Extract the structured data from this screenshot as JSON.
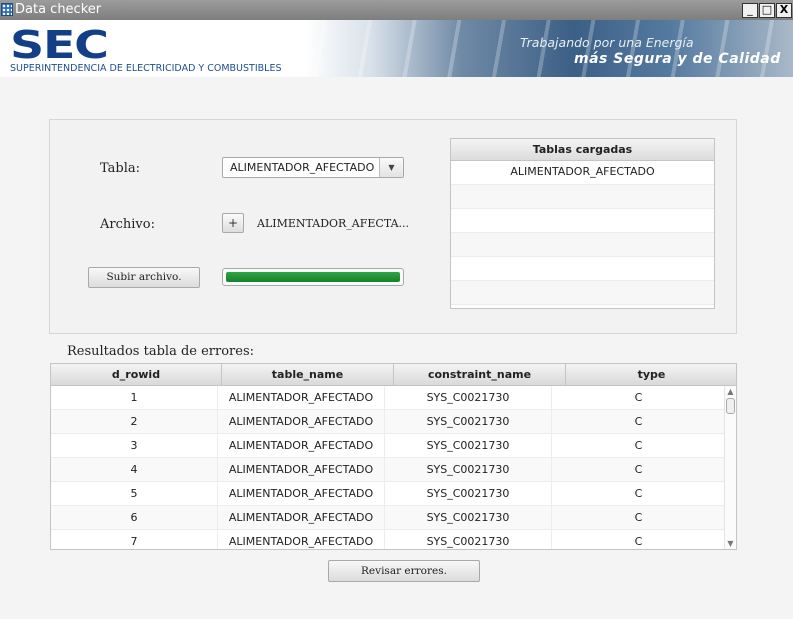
{
  "window": {
    "title": "Data checker",
    "controls": {
      "minimize": "_",
      "maximize": "□",
      "close": "X"
    }
  },
  "banner": {
    "logo_text": "SEC",
    "logo_subtitle": "SUPERINTENDENCIA DE ELECTRICIDAD Y COMBUSTIBLES",
    "slogan_line1": "Trabajando por una Energía",
    "slogan_line2": "más Segura y de Calidad",
    "brand_color": "#123f86"
  },
  "upload": {
    "tabla_label": "Tabla:",
    "tabla_selected": "ALIMENTADOR_AFECTADO",
    "archivo_label": "Archivo:",
    "browse_label": "+",
    "archivo_value": "ALIMENTADOR_AFECTA...",
    "upload_button": "Subir archivo.",
    "progress_fraction": 1.0,
    "progress_color": "#1f8f35"
  },
  "loaded_tables": {
    "header": "Tablas cargadas",
    "rows": [
      "ALIMENTADOR_AFECTADO",
      "",
      "",
      "",
      "",
      ""
    ]
  },
  "results": {
    "title": "Resultados tabla de errores:",
    "columns": [
      "d_rowid",
      "table_name",
      "constraint_name",
      "type"
    ],
    "rows": [
      [
        "1",
        "ALIMENTADOR_AFECTADO",
        "SYS_C0021730",
        "C"
      ],
      [
        "2",
        "ALIMENTADOR_AFECTADO",
        "SYS_C0021730",
        "C"
      ],
      [
        "3",
        "ALIMENTADOR_AFECTADO",
        "SYS_C0021730",
        "C"
      ],
      [
        "4",
        "ALIMENTADOR_AFECTADO",
        "SYS_C0021730",
        "C"
      ],
      [
        "5",
        "ALIMENTADOR_AFECTADO",
        "SYS_C0021730",
        "C"
      ],
      [
        "6",
        "ALIMENTADOR_AFECTADO",
        "SYS_C0021730",
        "C"
      ],
      [
        "7",
        "ALIMENTADOR_AFECTADO",
        "SYS_C0021730",
        "C"
      ]
    ],
    "review_button": "Revisar errores."
  }
}
